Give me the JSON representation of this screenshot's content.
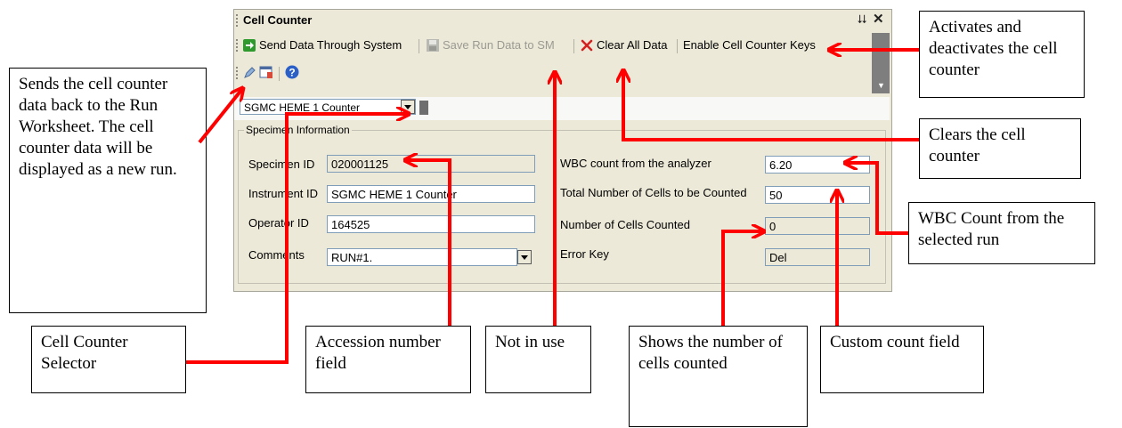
{
  "window": {
    "title": "Cell Counter",
    "pin_glyph": "⮇",
    "close_glyph": "✕"
  },
  "toolbar": {
    "send_label": "Send Data Through System",
    "save_label": "Save Run Data to SM",
    "clear_label": "Clear All Data",
    "enable_label": "Enable Cell Counter Keys"
  },
  "counter_selector": {
    "value": "SGMC HEME 1 Counter"
  },
  "specimen": {
    "legend": "Specimen Information",
    "specimen_id_label": "Specimen ID",
    "specimen_id": "020001125",
    "instrument_id_label": "Instrument ID",
    "instrument_id": "SGMC HEME 1 Counter",
    "operator_id_label": "Operator ID",
    "operator_id": "164525",
    "comments_label": "Comments",
    "comments": "RUN#1.",
    "wbc_label": "WBC count from the analyzer",
    "wbc": "6.20",
    "total_label": "Total Number of Cells to be Counted",
    "total": "50",
    "counted_label": "Number of Cells Counted",
    "counted": "0",
    "error_label": "Error Key",
    "error": "Del"
  },
  "callouts": {
    "send": "Sends the cell counter data back to the Run Worksheet. The cell counter data will be displayed as a new run.",
    "activates": "Activates and deactivates the cell counter",
    "clears": "Clears the cell counter",
    "wbc": "WBC Count from the selected run",
    "selector": "Cell Counter Selector",
    "accession": "Accession number field",
    "not_in_use": "Not in use",
    "shows": "Shows the number of cells counted",
    "custom": "Custom count field"
  },
  "colors": {
    "arrow": "#ff0000",
    "window_bg": "#ece9d8"
  }
}
